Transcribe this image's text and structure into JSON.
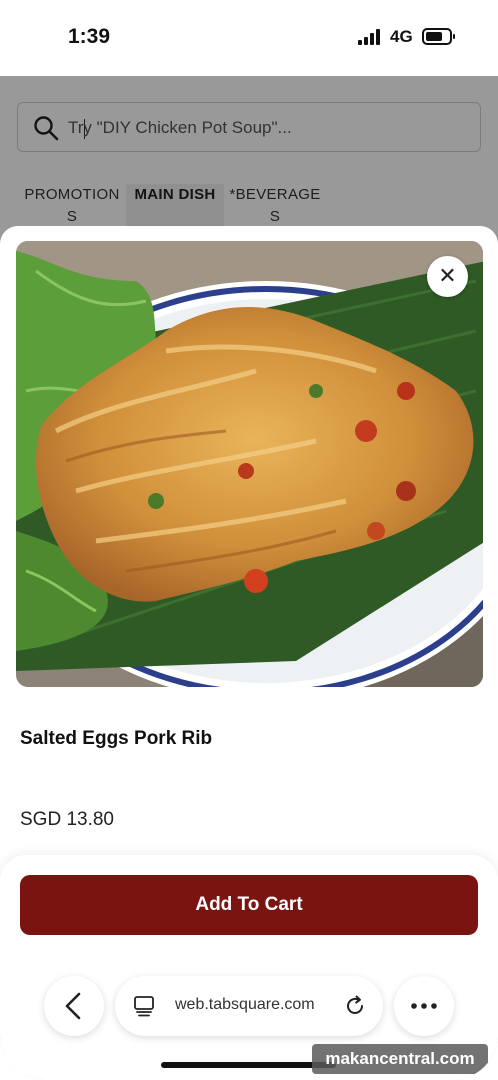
{
  "status_bar": {
    "time": "1:39",
    "network": "4G"
  },
  "search": {
    "placeholder": "Try \"DIY Chicken Pot Soup\"..."
  },
  "tabs": [
    {
      "label": "PROMOTIONS",
      "selected": false
    },
    {
      "label": "MAIN DISH",
      "selected": true
    },
    {
      "label": "*BEVERAGES",
      "selected": false
    }
  ],
  "item": {
    "name": "Salted Eggs Pork Rib",
    "price": "SGD 13.80",
    "close_icon": "close-icon"
  },
  "actions": {
    "add_to_cart_label": "Add To Cart"
  },
  "browser": {
    "url": "web.tabsquare.com"
  },
  "watermark": "makancentral.com",
  "colors": {
    "accent": "#7a1410",
    "scrim": "rgba(0,0,0,0.4)"
  },
  "icons": [
    "search-icon",
    "close-icon",
    "back-chevron-icon",
    "tabs-icon",
    "reload-icon",
    "more-dots-icon"
  ]
}
